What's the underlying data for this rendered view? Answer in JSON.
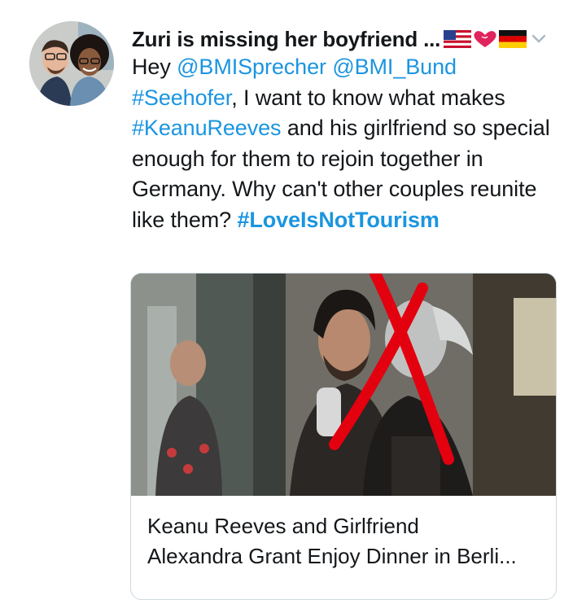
{
  "tweet": {
    "display_name": "Zuri is missing her boyfriend ...",
    "badge_icons": [
      "us-flag-icon",
      "heart-icon",
      "german-flag-icon"
    ],
    "menu_icon": "chevron-down-icon",
    "text": {
      "w1": "Hey ",
      "mention1": "@BMISprecher",
      "sp1": " ",
      "mention2": "@BMI_Bund",
      "hashtag1": "#Seehofer",
      "t2": ", I want to know what makes ",
      "hashtag2": "#KeanuReeves",
      "t3": " and his girlfriend so special enough for them to rejoin together in Germany. Why can't other couples reunite like them? ",
      "hashtag3": "#LoveIsNotTourism"
    },
    "colors": {
      "link": "#1b95e0",
      "annotation": "#e3000f"
    }
  },
  "card": {
    "title_line1": "Keanu Reeves and Girlfriend",
    "title_line2": "Alexandra Grant Enjoy Dinner in Berli..."
  }
}
